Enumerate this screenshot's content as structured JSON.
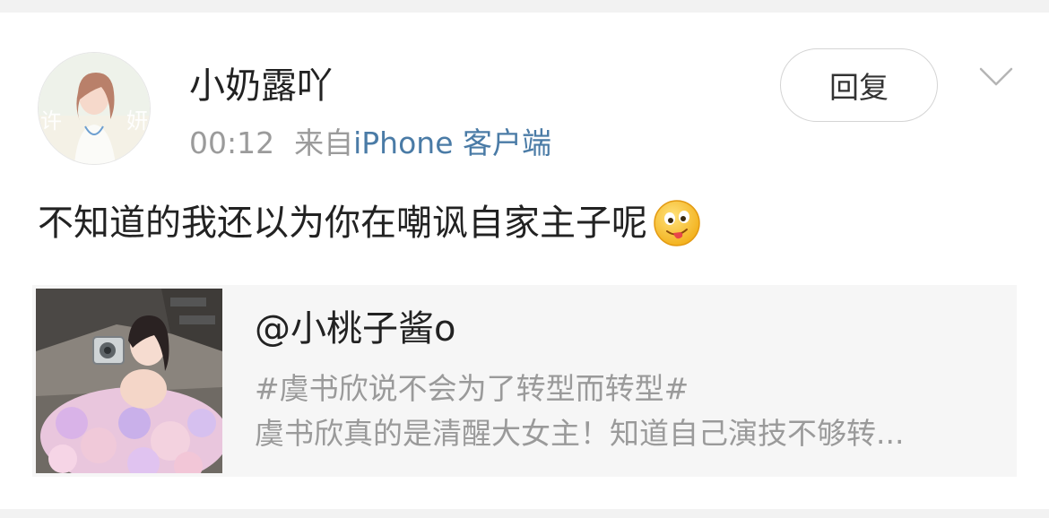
{
  "post": {
    "username": "小奶露吖",
    "time": "00:12",
    "source_prefix": "来自",
    "source": "iPhone 客户端",
    "reply_label": "回复",
    "text": "不知道的我还以为你在嘲讽自家主子呢",
    "emoji": "tongue-out-emoji"
  },
  "quote": {
    "user": "@小桃子酱o",
    "line1": "#虞书欣说不会为了转型而转型#",
    "line2": "虞书欣真的是清醒大女主！知道自己演技不够转..."
  },
  "colors": {
    "link": "#4a7ba6",
    "muted": "#9b9b9b",
    "quote_bg": "#f6f6f6"
  }
}
